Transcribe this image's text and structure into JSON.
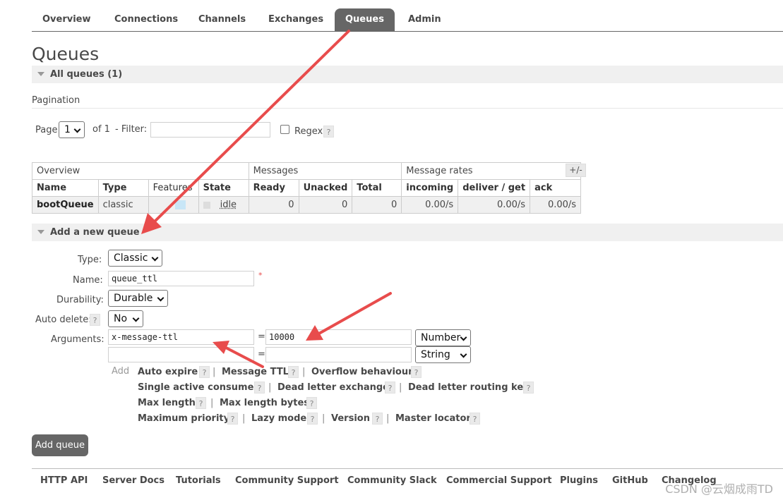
{
  "nav": {
    "tabs": [
      "Overview",
      "Connections",
      "Channels",
      "Exchanges",
      "Queues",
      "Admin"
    ],
    "active": "Queues"
  },
  "page_title": "Queues",
  "all_queues": {
    "label": "All queues (1)"
  },
  "pagination": {
    "label": "Pagination",
    "page_label": "Page",
    "page_value": "1",
    "of_label": "of 1",
    "filter_label": "- Filter:",
    "filter_value": "",
    "regex_label": "Regex",
    "help": "?"
  },
  "table": {
    "group_headers": [
      "Overview",
      "Messages",
      "Message rates"
    ],
    "plus_minus": "+/-",
    "columns": [
      "Name",
      "Type",
      "Features",
      "State",
      "Ready",
      "Unacked",
      "Total",
      "incoming",
      "deliver / get",
      "ack"
    ],
    "rows": [
      {
        "name": "bootQueue",
        "type": "classic",
        "features": "D",
        "state": "idle",
        "ready": "0",
        "unacked": "0",
        "total": "0",
        "incoming": "0.00/s",
        "deliver_get": "0.00/s",
        "ack": "0.00/s"
      }
    ]
  },
  "add_queue": {
    "section_label": "Add a new queue",
    "type_label": "Type:",
    "type_value": "Classic",
    "name_label": "Name:",
    "name_value": "queue_ttl",
    "required_mark": "*",
    "durability_label": "Durability:",
    "durability_value": "Durable",
    "auto_delete_label": "Auto delete:",
    "auto_delete_value": "No",
    "arguments_label": "Arguments:",
    "arg1_key": "x-message-ttl",
    "arg1_value": "10000",
    "arg1_type": "Number",
    "arg2_key": "",
    "arg2_value": "",
    "arg2_type": "String",
    "equals": "=",
    "add_label": "Add",
    "arg_links": {
      "auto_expire": "Auto expire",
      "message_ttl": "Message TTL",
      "overflow_behaviour": "Overflow behaviour",
      "single_active_consumer": "Single active consumer",
      "dead_letter_exchange": "Dead letter exchange",
      "dead_letter_routing_key": "Dead letter routing key",
      "max_length": "Max length",
      "max_length_bytes": "Max length bytes",
      "maximum_priority": "Maximum priority",
      "lazy_mode": "Lazy mode",
      "version": "Version",
      "master_locator": "Master locator"
    },
    "sep": "|",
    "button_label": "Add queue"
  },
  "footer": {
    "links": [
      "HTTP API",
      "Server Docs",
      "Tutorials",
      "Community Support",
      "Community Slack",
      "Commercial Support",
      "Plugins",
      "GitHub",
      "Changelog"
    ]
  },
  "watermark": "CSDN @云烟成雨TD",
  "colors": {
    "annotation_arrow": "#e84c4c",
    "active_tab": "#666666",
    "section_bg": "#f0f0f0"
  }
}
